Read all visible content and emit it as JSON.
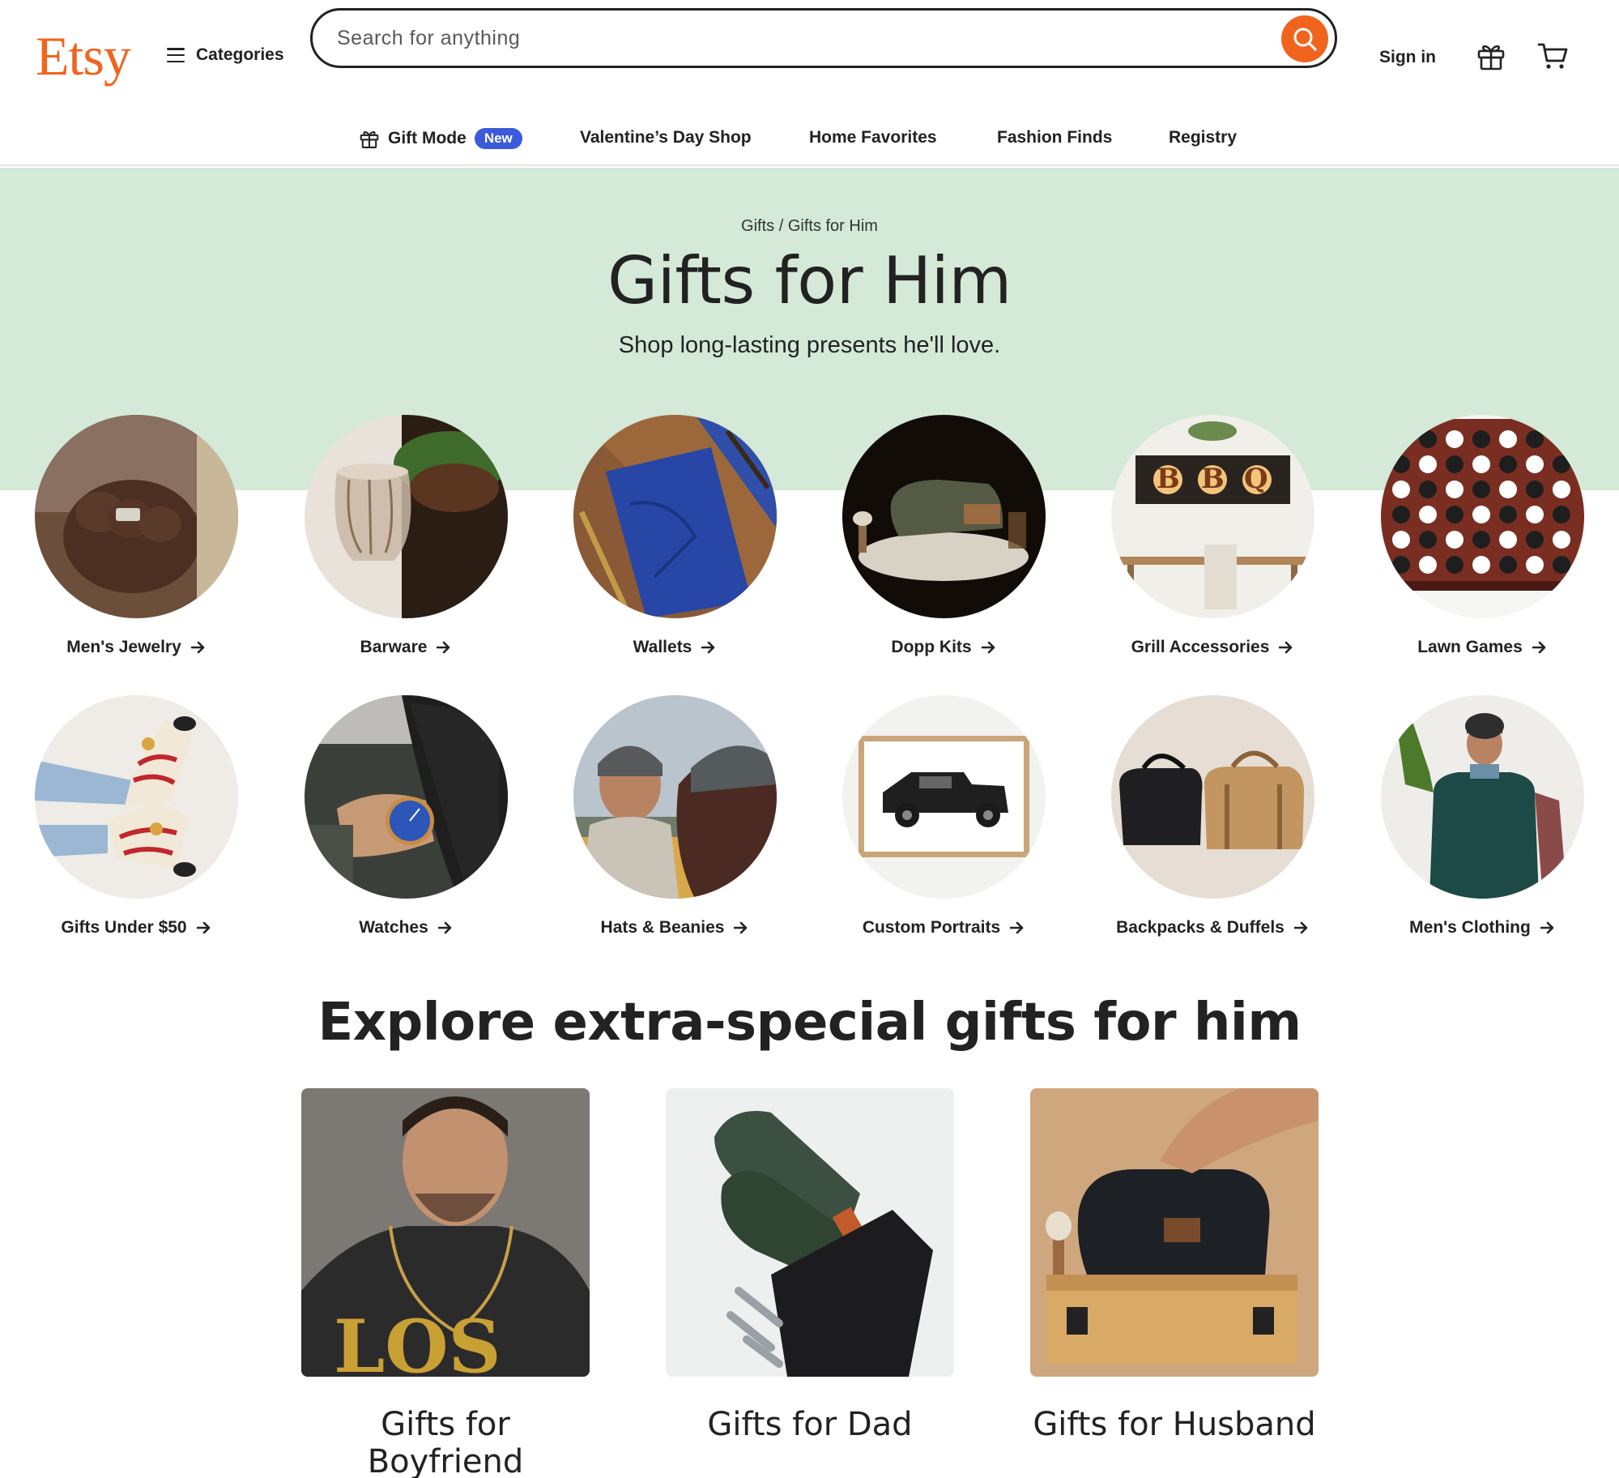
{
  "header": {
    "logo": "Etsy",
    "categories_label": "Categories",
    "search_placeholder": "Search for anything",
    "signin_label": "Sign in"
  },
  "subnav": {
    "gift_mode": "Gift Mode",
    "gift_mode_badge": "New",
    "items": [
      "Valentine’s Day Shop",
      "Home Favorites",
      "Fashion Finds",
      "Registry"
    ]
  },
  "hero": {
    "breadcrumb": "Gifts / Gifts for Him",
    "title": "Gifts for Him",
    "subtitle": "Shop long-lasting presents he'll love."
  },
  "categories": [
    {
      "label": "Men's Jewelry"
    },
    {
      "label": "Barware"
    },
    {
      "label": "Wallets"
    },
    {
      "label": "Dopp Kits"
    },
    {
      "label": "Grill Accessories"
    },
    {
      "label": "Lawn Games"
    },
    {
      "label": "Gifts Under $50"
    },
    {
      "label": "Watches"
    },
    {
      "label": "Hats & Beanies"
    },
    {
      "label": "Custom Portraits"
    },
    {
      "label": "Backpacks & Duffels"
    },
    {
      "label": "Men's Clothing"
    }
  ],
  "explore": {
    "title": "Explore extra-special gifts for him",
    "cards": [
      {
        "label": "Gifts for Boyfriend"
      },
      {
        "label": "Gifts for Dad"
      },
      {
        "label": "Gifts for Husband"
      }
    ]
  },
  "colors": {
    "brand": "#F1641E",
    "hero_bg": "#D4E9D7",
    "badge": "#3B5BDB"
  },
  "icons": [
    "hamburger-icon",
    "search-icon",
    "gift-icon",
    "cart-icon",
    "arrow-right-icon"
  ]
}
